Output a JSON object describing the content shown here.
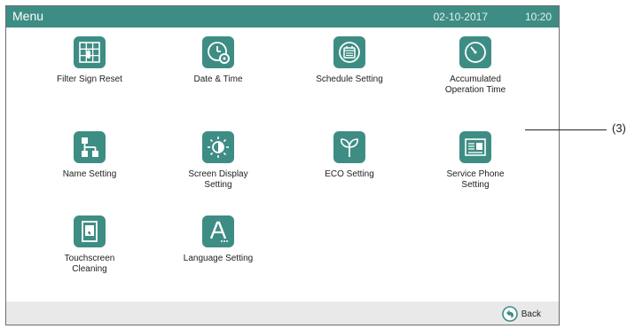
{
  "header": {
    "title": "Menu",
    "date": "02-10-2017",
    "time": "10:20"
  },
  "menu": {
    "items": [
      {
        "label": "Filter Sign Reset",
        "icon": "filter-grid-icon"
      },
      {
        "label": "Date & Time",
        "icon": "clock-gear-icon"
      },
      {
        "label": "Schedule Setting",
        "icon": "calendar-icon"
      },
      {
        "label": "Accumulated Operation Time",
        "icon": "timer-icon"
      },
      {
        "label": "Name Setting",
        "icon": "hierarchy-icon"
      },
      {
        "label": "Screen Display Setting",
        "icon": "brightness-icon"
      },
      {
        "label": "ECO Setting",
        "icon": "sprout-icon"
      },
      {
        "label": "Service Phone Setting",
        "icon": "contact-card-icon"
      },
      {
        "label": "Touchscreen Cleaning",
        "icon": "touch-panel-icon"
      },
      {
        "label": "Language Setting",
        "icon": "letter-a-icon"
      }
    ]
  },
  "footer": {
    "back_label": "Back",
    "back_icon": "back-arrow-icon"
  },
  "annotation": {
    "callout": "(3)"
  },
  "colors": {
    "accent": "#3e8d84",
    "footer_bg": "#e9e9e9",
    "border": "#6d6d6d"
  }
}
